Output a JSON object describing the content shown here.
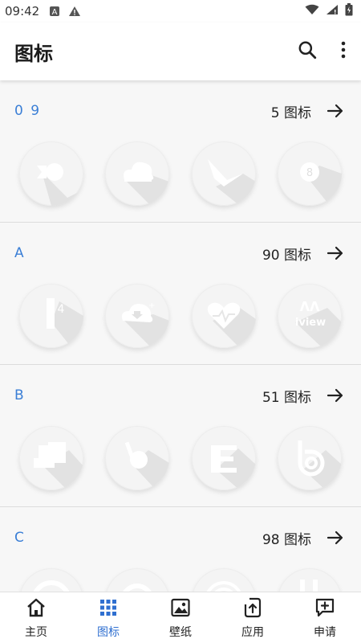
{
  "status_bar": {
    "time": "09:42"
  },
  "app_bar": {
    "title": "图标"
  },
  "sections": [
    {
      "title": "0 9",
      "count": "5 图标"
    },
    {
      "title": "A",
      "count": "90 图标"
    },
    {
      "title": "B",
      "count": "51 图标"
    },
    {
      "title": "C",
      "count": "98 图标"
    }
  ],
  "bottom_nav": [
    {
      "label": "主页",
      "icon": "home-icon"
    },
    {
      "label": "图标",
      "icon": "grid-icon",
      "active": true
    },
    {
      "label": "壁纸",
      "icon": "wallpaper-icon"
    },
    {
      "label": "应用",
      "icon": "apply-icon"
    },
    {
      "label": "申请",
      "icon": "request-icon"
    }
  ],
  "colors": {
    "accent": "#3b7fd6",
    "active_nav": "#2f6fd0"
  }
}
